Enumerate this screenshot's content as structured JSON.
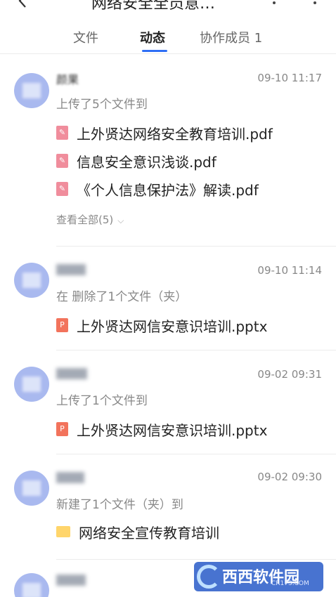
{
  "header": {
    "title": "网络安全全员意…",
    "back_icon": "back-arrow-icon",
    "more_icon": "more-icon"
  },
  "tabs": [
    {
      "label": "文件",
      "active": false
    },
    {
      "label": "动态",
      "active": true
    },
    {
      "label": "协作成员 1",
      "active": false
    }
  ],
  "accent_color": "#2f6ff5",
  "feed": [
    {
      "name": "颜果",
      "time": "09-10 11:17",
      "action": "上传了5个文件到",
      "files": [
        {
          "type": "pdf",
          "name": "上外贤达网络安全教育培训.pdf"
        },
        {
          "type": "pdf",
          "name": "信息安全意识浅谈.pdf"
        },
        {
          "type": "pdf",
          "name": "《个人信息保护法》解读.pdf"
        }
      ],
      "view_all": "查看全部(5)"
    },
    {
      "name": "",
      "time": "09-10 11:14",
      "action": "在  删除了1个文件（夹）",
      "files": [
        {
          "type": "pptx",
          "name": "上外贤达网信安意识培训.pptx"
        }
      ]
    },
    {
      "name": "",
      "time": "09-02 09:31",
      "action": "上传了1个文件到",
      "files": [
        {
          "type": "pptx",
          "name": "上外贤达网信安意识培训.pptx"
        }
      ]
    },
    {
      "name": "",
      "time": "09-02 09:30",
      "action": "新建了1个文件（夹）到",
      "files": [
        {
          "type": "folder",
          "name": "网络安全宣传教育培训"
        }
      ]
    },
    {
      "name": "",
      "time": "",
      "action": "",
      "files": []
    }
  ],
  "watermark": {
    "text": "西西软件园",
    "sub": "CR173.COM"
  }
}
